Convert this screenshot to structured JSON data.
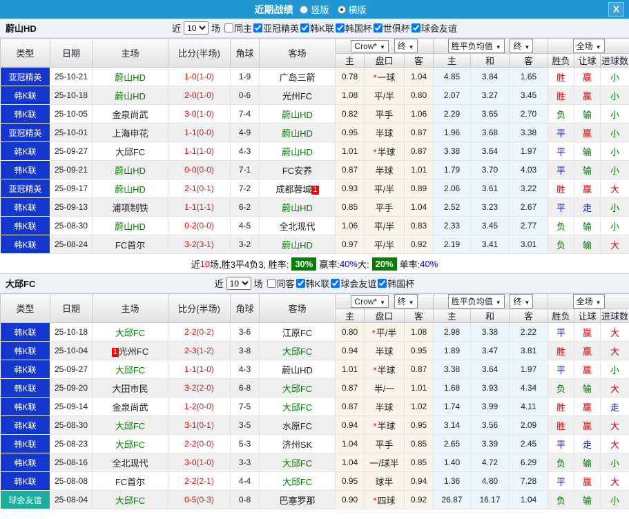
{
  "colors": {
    "accent": "#2096d3",
    "blue_type": "#1437cf",
    "teal_type": "#1bae9c",
    "red": "#e60000",
    "blue": "#0016e6",
    "green": "#008000",
    "score_red": "#ff0000",
    "score_half": "#993333",
    "pan_col_bg": "#faf4eb",
    "avg_col_bg": "#ecf5fb"
  },
  "titlebar": {
    "title": "近期战绩",
    "radios": [
      {
        "label": "竖版",
        "checked": false
      },
      {
        "label": "横版",
        "checked": true
      }
    ],
    "close": "X"
  },
  "hdr": {
    "cols": [
      "类型",
      "日期",
      "主场",
      "比分(半场)",
      "角球",
      "客场"
    ],
    "odds_dd": "Crow*",
    "odds_fin": "终",
    "odds_sub": [
      "主",
      "盘口",
      "客"
    ],
    "avg_dd": "胜平负均值",
    "avg_fin": "终",
    "avg_sub": [
      "主",
      "和",
      "客"
    ],
    "full_dd": "全场",
    "full_sub": [
      "胜负",
      "让球",
      "进球数"
    ],
    "arrow": "▼"
  },
  "sections": [
    {
      "team": "蔚山HD",
      "filter": {
        "near": "近",
        "count": "10",
        "matches": "场",
        "same": "同主",
        "same_checked": false,
        "leagues": [
          "亚冠精英",
          "韩K联",
          "韩国杯",
          "世俱杯",
          "球会友谊"
        ]
      },
      "rows": [
        {
          "league": "亚冠精英",
          "lcolor": "blue_type",
          "date": "25-10-21",
          "home": "蔚山HD",
          "hg": true,
          "hb": "",
          "score": "1-0",
          "half": "(1-0)",
          "corner": "1-9",
          "away": "广岛三箭",
          "ag": false,
          "ab": "",
          "o": [
            "0.78",
            "*一球",
            "1.04"
          ],
          "avg": [
            "4.85",
            "3.84",
            "1.65"
          ],
          "res": [
            [
              "胜",
              "red"
            ],
            [
              "赢",
              "red"
            ],
            [
              "小",
              "green"
            ]
          ]
        },
        {
          "league": "韩K联",
          "lcolor": "blue_type",
          "date": "25-10-18",
          "home": "蔚山HD",
          "hg": true,
          "hb": "",
          "score": "2-0",
          "half": "(1-0)",
          "corner": "0-6",
          "away": "光州FC",
          "ag": false,
          "ab": "",
          "o": [
            "1.08",
            "平/半",
            "0.80"
          ],
          "avg": [
            "2.07",
            "3.27",
            "3.45"
          ],
          "res": [
            [
              "胜",
              "red"
            ],
            [
              "赢",
              "red"
            ],
            [
              "小",
              "green"
            ]
          ]
        },
        {
          "league": "韩K联",
          "lcolor": "blue_type",
          "date": "25-10-05",
          "home": "金泉尚武",
          "hg": false,
          "hb": "",
          "score": "3-0",
          "half": "(1-0)",
          "corner": "7-4",
          "away": "蔚山HD",
          "ag": true,
          "ab": "",
          "o": [
            "0.82",
            "平手",
            "1.06"
          ],
          "avg": [
            "2.29",
            "3.65",
            "2.70"
          ],
          "res": [
            [
              "负",
              "green"
            ],
            [
              "输",
              "green"
            ],
            [
              "小",
              "green"
            ]
          ]
        },
        {
          "league": "亚冠精英",
          "lcolor": "blue_type",
          "date": "25-10-01",
          "home": "上海申花",
          "hg": false,
          "hb": "",
          "score": "1-1",
          "half": "(0-0)",
          "corner": "4-9",
          "away": "蔚山HD",
          "ag": true,
          "ab": "",
          "o": [
            "0.95",
            "半球",
            "0.87"
          ],
          "avg": [
            "1.96",
            "3.68",
            "3.38"
          ],
          "res": [
            [
              "平",
              "blue"
            ],
            [
              "赢",
              "red"
            ],
            [
              "小",
              "green"
            ]
          ]
        },
        {
          "league": "韩K联",
          "lcolor": "blue_type",
          "date": "25-09-27",
          "home": "大邱FC",
          "hg": false,
          "hb": "",
          "score": "1-1",
          "half": "(1-0)",
          "corner": "4-3",
          "away": "蔚山HD",
          "ag": true,
          "ab": "",
          "o": [
            "1.01",
            "*半球",
            "0.87"
          ],
          "avg": [
            "3.38",
            "3.64",
            "1.97"
          ],
          "res": [
            [
              "平",
              "blue"
            ],
            [
              "输",
              "green"
            ],
            [
              "小",
              "green"
            ]
          ]
        },
        {
          "league": "韩K联",
          "lcolor": "blue_type",
          "date": "25-09-21",
          "home": "蔚山HD",
          "hg": true,
          "hb": "",
          "score": "0-0",
          "half": "(0-0)",
          "corner": "7-1",
          "away": "FC安养",
          "ag": false,
          "ab": "",
          "o": [
            "0.87",
            "半球",
            "1.01"
          ],
          "avg": [
            "1.79",
            "3.70",
            "4.03"
          ],
          "res": [
            [
              "平",
              "blue"
            ],
            [
              "输",
              "green"
            ],
            [
              "小",
              "green"
            ]
          ]
        },
        {
          "league": "亚冠精英",
          "lcolor": "blue_type",
          "date": "25-09-17",
          "home": "蔚山HD",
          "hg": true,
          "hb": "",
          "score": "2-1",
          "half": "(0-1)",
          "corner": "7-2",
          "away": "成都蓉城",
          "ag": false,
          "ab": "1",
          "o": [
            "0.93",
            "平/半",
            "0.89"
          ],
          "avg": [
            "2.06",
            "3.61",
            "3.22"
          ],
          "res": [
            [
              "胜",
              "red"
            ],
            [
              "赢",
              "red"
            ],
            [
              "大",
              "red"
            ]
          ]
        },
        {
          "league": "韩K联",
          "lcolor": "blue_type",
          "date": "25-09-13",
          "home": "浦项制铁",
          "hg": false,
          "hb": "",
          "score": "1-1",
          "half": "(1-1)",
          "corner": "6-2",
          "away": "蔚山HD",
          "ag": true,
          "ab": "",
          "o": [
            "0.85",
            "平手",
            "1.04"
          ],
          "avg": [
            "2.52",
            "3.23",
            "2.67"
          ],
          "res": [
            [
              "平",
              "blue"
            ],
            [
              "走",
              "blue"
            ],
            [
              "小",
              "green"
            ]
          ]
        },
        {
          "league": "韩K联",
          "lcolor": "blue_type",
          "date": "25-08-30",
          "home": "蔚山HD",
          "hg": true,
          "hb": "",
          "score": "0-2",
          "half": "(0-0)",
          "corner": "4-5",
          "away": "全北现代",
          "ag": false,
          "ab": "",
          "o": [
            "1.06",
            "平/半",
            "0.83"
          ],
          "avg": [
            "2.33",
            "3.45",
            "2.77"
          ],
          "res": [
            [
              "负",
              "green"
            ],
            [
              "输",
              "green"
            ],
            [
              "小",
              "green"
            ]
          ]
        },
        {
          "league": "韩K联",
          "lcolor": "blue_type",
          "date": "25-08-24",
          "home": "FC首尔",
          "hg": false,
          "hb": "",
          "score": "3-2",
          "half": "(3-1)",
          "corner": "3-2",
          "away": "蔚山HD",
          "ag": true,
          "ab": "",
          "o": [
            "0.97",
            "平/半",
            "0.92"
          ],
          "avg": [
            "2.19",
            "3.41",
            "3.01"
          ],
          "res": [
            [
              "负",
              "green"
            ],
            [
              "输",
              "green"
            ],
            [
              "大",
              "red"
            ]
          ]
        }
      ],
      "summary_parts": [
        {
          "t": "近",
          "k": "text"
        },
        {
          "t": "10",
          "k": "red"
        },
        {
          "t": "场,胜3平4负3, 胜率: ",
          "k": "text"
        },
        {
          "t": "30%",
          "k": "badge"
        },
        {
          "t": " 赢率:",
          "k": "text"
        },
        {
          "t": "40%",
          "k": "blue"
        },
        {
          "t": " 大: ",
          "k": "text"
        },
        {
          "t": "20%",
          "k": "badge"
        },
        {
          "t": " 单率:",
          "k": "text"
        },
        {
          "t": "40%",
          "k": "blue"
        }
      ]
    },
    {
      "team": "大邱FC",
      "filter": {
        "near": "近",
        "count": "10",
        "matches": "场",
        "same": "同客",
        "same_checked": false,
        "leagues": [
          "韩K联",
          "球会友谊",
          "韩国杯"
        ]
      },
      "rows": [
        {
          "league": "韩K联",
          "lcolor": "blue_type",
          "date": "25-10-18",
          "home": "大邱FC",
          "hg": true,
          "hb": "",
          "score": "2-2",
          "half": "(0-2)",
          "corner": "3-6",
          "away": "江原FC",
          "ag": false,
          "ab": "",
          "o": [
            "0.80",
            "*平/半",
            "1.08"
          ],
          "avg": [
            "2.98",
            "3.38",
            "2.22"
          ],
          "res": [
            [
              "平",
              "blue"
            ],
            [
              "赢",
              "red"
            ],
            [
              "大",
              "red"
            ]
          ]
        },
        {
          "league": "韩K联",
          "lcolor": "blue_type",
          "date": "25-10-04",
          "home": "光州FC",
          "hg": false,
          "hb": "1",
          "score": "2-3",
          "half": "(1-2)",
          "corner": "3-8",
          "away": "大邱FC",
          "ag": true,
          "ab": "",
          "o": [
            "0.94",
            "半球",
            "0.95"
          ],
          "avg": [
            "1.89",
            "3.47",
            "3.81"
          ],
          "res": [
            [
              "胜",
              "red"
            ],
            [
              "赢",
              "red"
            ],
            [
              "大",
              "red"
            ]
          ]
        },
        {
          "league": "韩K联",
          "lcolor": "blue_type",
          "date": "25-09-27",
          "home": "大邱FC",
          "hg": true,
          "hb": "",
          "score": "1-1",
          "half": "(1-0)",
          "corner": "4-3",
          "away": "蔚山HD",
          "ag": false,
          "ab": "",
          "o": [
            "1.01",
            "*半球",
            "0.87"
          ],
          "avg": [
            "3.38",
            "3.64",
            "1.97"
          ],
          "res": [
            [
              "平",
              "blue"
            ],
            [
              "赢",
              "red"
            ],
            [
              "小",
              "green"
            ]
          ]
        },
        {
          "league": "韩K联",
          "lcolor": "blue_type",
          "date": "25-09-20",
          "home": "大田市民",
          "hg": false,
          "hb": "",
          "score": "3-2",
          "half": "(2-0)",
          "corner": "6-8",
          "away": "大邱FC",
          "ag": true,
          "ab": "",
          "o": [
            "0.87",
            "半/一",
            "1.01"
          ],
          "avg": [
            "1.68",
            "3.93",
            "4.34"
          ],
          "res": [
            [
              "负",
              "green"
            ],
            [
              "输",
              "green"
            ],
            [
              "大",
              "red"
            ]
          ]
        },
        {
          "league": "韩K联",
          "lcolor": "blue_type",
          "date": "25-09-14",
          "home": "金泉尚武",
          "hg": false,
          "hb": "",
          "score": "1-2",
          "half": "(0-0)",
          "corner": "7-5",
          "away": "大邱FC",
          "ag": true,
          "ab": "",
          "o": [
            "0.87",
            "半球",
            "1.02"
          ],
          "avg": [
            "1.74",
            "3.99",
            "4.11"
          ],
          "res": [
            [
              "胜",
              "red"
            ],
            [
              "赢",
              "red"
            ],
            [
              "走",
              "blue"
            ]
          ]
        },
        {
          "league": "韩K联",
          "lcolor": "blue_type",
          "date": "25-08-30",
          "home": "大邱FC",
          "hg": true,
          "hb": "",
          "score": "3-1",
          "half": "(0-1)",
          "corner": "3-5",
          "away": "水原FC",
          "ag": false,
          "ab": "",
          "o": [
            "0.94",
            "*半球",
            "0.95"
          ],
          "avg": [
            "3.14",
            "3.56",
            "2.09"
          ],
          "res": [
            [
              "胜",
              "red"
            ],
            [
              "赢",
              "red"
            ],
            [
              "大",
              "red"
            ]
          ]
        },
        {
          "league": "韩K联",
          "lcolor": "blue_type",
          "date": "25-08-23",
          "home": "大邱FC",
          "hg": true,
          "hb": "",
          "score": "2-2",
          "half": "(0-0)",
          "corner": "5-3",
          "away": "济州SK",
          "ag": false,
          "ab": "",
          "o": [
            "1.04",
            "平手",
            "0.85"
          ],
          "avg": [
            "2.65",
            "3.39",
            "2.45"
          ],
          "res": [
            [
              "平",
              "blue"
            ],
            [
              "走",
              "blue"
            ],
            [
              "大",
              "red"
            ]
          ]
        },
        {
          "league": "韩K联",
          "lcolor": "blue_type",
          "date": "25-08-16",
          "home": "全北现代",
          "hg": false,
          "hb": "",
          "score": "3-0",
          "half": "(1-0)",
          "corner": "3-3",
          "away": "大邱FC",
          "ag": true,
          "ab": "",
          "o": [
            "1.04",
            "一/球半",
            "0.85"
          ],
          "avg": [
            "1.40",
            "4.72",
            "6.29"
          ],
          "res": [
            [
              "负",
              "green"
            ],
            [
              "输",
              "green"
            ],
            [
              "小",
              "green"
            ]
          ]
        },
        {
          "league": "韩K联",
          "lcolor": "blue_type",
          "date": "25-08-08",
          "home": "FC首尔",
          "hg": false,
          "hb": "",
          "score": "2-2",
          "half": "(2-1)",
          "corner": "4-4",
          "away": "大邱FC",
          "ag": true,
          "ab": "",
          "o": [
            "0.95",
            "球半",
            "0.94"
          ],
          "avg": [
            "1.36",
            "4.80",
            "7.28"
          ],
          "res": [
            [
              "平",
              "blue"
            ],
            [
              "赢",
              "red"
            ],
            [
              "大",
              "red"
            ]
          ]
        },
        {
          "league": "球会友谊",
          "lcolor": "teal_type",
          "date": "25-08-04",
          "home": "大邱FC",
          "hg": true,
          "hb": "",
          "score": "0-5",
          "half": "(0-3)",
          "corner": "0-8",
          "away": "巴塞罗那",
          "ag": false,
          "ab": "",
          "o": [
            "0.90",
            "*四球",
            "0.92"
          ],
          "avg": [
            "26.87",
            "16.17",
            "1.04"
          ],
          "res": [
            [
              "负",
              "green"
            ],
            [
              "输",
              "green"
            ],
            [
              "小",
              "green"
            ]
          ]
        }
      ],
      "summary_parts": []
    }
  ]
}
